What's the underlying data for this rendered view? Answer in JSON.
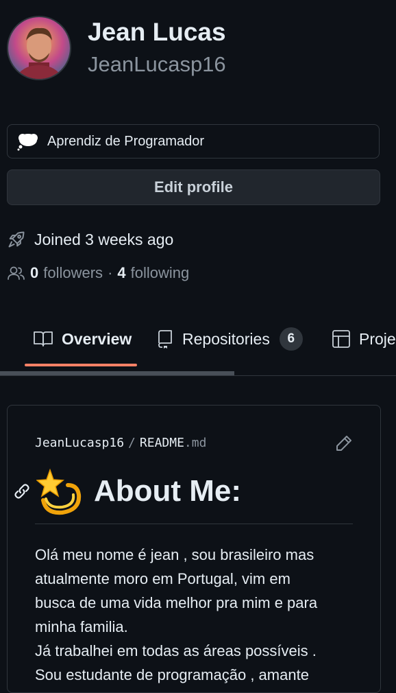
{
  "profile": {
    "name": "Jean Lucas",
    "login": "JeanLucasp16",
    "status": "Aprendiz de Programador",
    "edit_label": "Edit profile",
    "joined": "Joined 3 weeks ago",
    "followers_count": "0",
    "followers_label": "followers",
    "separator": "·",
    "following_count": "4",
    "following_label": "following"
  },
  "tabs": [
    {
      "label": "Overview",
      "icon": "book-icon",
      "active": true
    },
    {
      "label": "Repositories",
      "icon": "repo-icon",
      "count": "6"
    },
    {
      "label": "Proje",
      "icon": "table-icon"
    }
  ],
  "readme": {
    "owner": "JeanLucasp16",
    "sep": "/",
    "file": "README",
    "ext": ".md",
    "heading": "About Me:",
    "lines": [
      "Olá meu nome é jean , sou brasileiro mas",
      "atualmente moro em Portugal, vim em",
      "busca de uma vida melhor pra mim e para",
      "minha familia.",
      "Já trabalhei em todas as áreas possíveis .",
      "Sou estudante de programação , amante"
    ]
  },
  "colors": {
    "background": "#0d1117",
    "border": "#30363d",
    "muted": "#8b949e",
    "tab_underline": "#f78166",
    "button": "#21262d"
  }
}
